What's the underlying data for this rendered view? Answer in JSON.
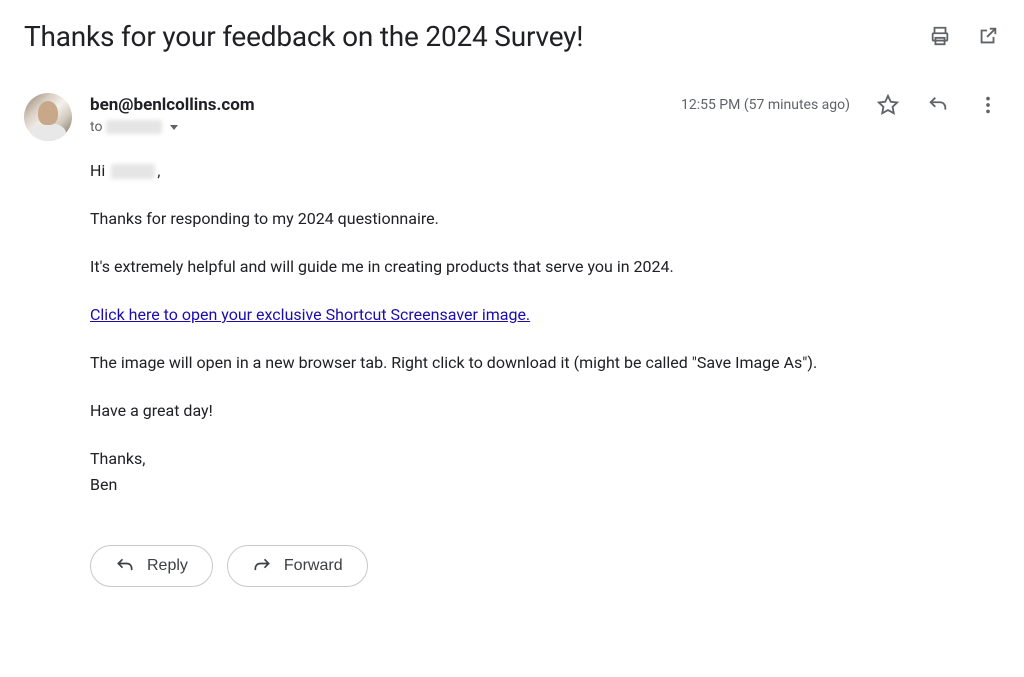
{
  "subject": "Thanks for your feedback on the 2024 Survey!",
  "sender": {
    "email": "ben@benlcollins.com",
    "to_prefix": "to"
  },
  "timestamp": "12:55 PM (57 minutes ago)",
  "body": {
    "greeting_prefix": "Hi",
    "greeting_suffix": ",",
    "p1": "Thanks for responding to my 2024 questionnaire.",
    "p2": "It's extremely helpful and will guide me in creating products that serve you in 2024.",
    "link_text": "Click here to open your exclusive Shortcut Screensaver image.",
    "p3": "The image will open in a new browser tab. Right click to download it (might be called \"Save Image As\").",
    "p4": "Have a great day!",
    "signoff1": "Thanks,",
    "signoff2": "Ben"
  },
  "actions": {
    "reply": "Reply",
    "forward": "Forward"
  }
}
